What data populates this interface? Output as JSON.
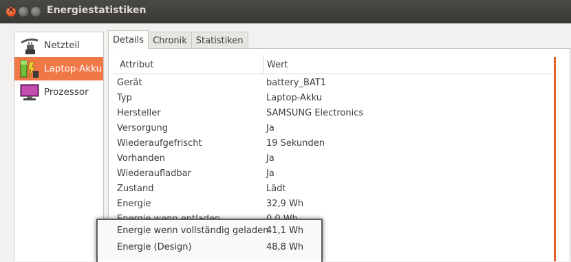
{
  "window": {
    "title": "Energiestatistiken",
    "accent": "#f07746"
  },
  "sidebar": {
    "items": [
      {
        "label": "Netzteil",
        "icon": "power-plug-icon"
      },
      {
        "label": "Laptop-Akku",
        "icon": "battery-icon",
        "selected": true
      },
      {
        "label": "Prozessor",
        "icon": "monitor-icon"
      }
    ]
  },
  "tabs": [
    {
      "label": "Details",
      "active": true
    },
    {
      "label": "Chronik"
    },
    {
      "label": "Statistiken"
    }
  ],
  "table": {
    "headers": {
      "attr": "Attribut",
      "value": "Wert"
    },
    "rows": [
      {
        "k": "Gerät",
        "v": "battery_BAT1"
      },
      {
        "k": "Typ",
        "v": "Laptop-Akku"
      },
      {
        "k": "Hersteller",
        "v": "SAMSUNG Electronics"
      },
      {
        "k": "Versorgung",
        "v": "Ja"
      },
      {
        "k": "Wiederaufgefrischt",
        "v": "19 Sekunden"
      },
      {
        "k": "Vorhanden",
        "v": "Ja"
      },
      {
        "k": "Wiederaufladbar",
        "v": "Ja"
      },
      {
        "k": "Zustand",
        "v": "Lädt"
      },
      {
        "k": "Energie",
        "v": "32,9 Wh"
      },
      {
        "k": "Energie wenn entladen",
        "v": "0,0 Wh"
      }
    ]
  },
  "highlight": {
    "rows": [
      {
        "k": "Energie wenn vollständig geladen",
        "v": "41,1 Wh"
      },
      {
        "k": "Energie (Design)",
        "v": "48,8 Wh"
      }
    ]
  }
}
